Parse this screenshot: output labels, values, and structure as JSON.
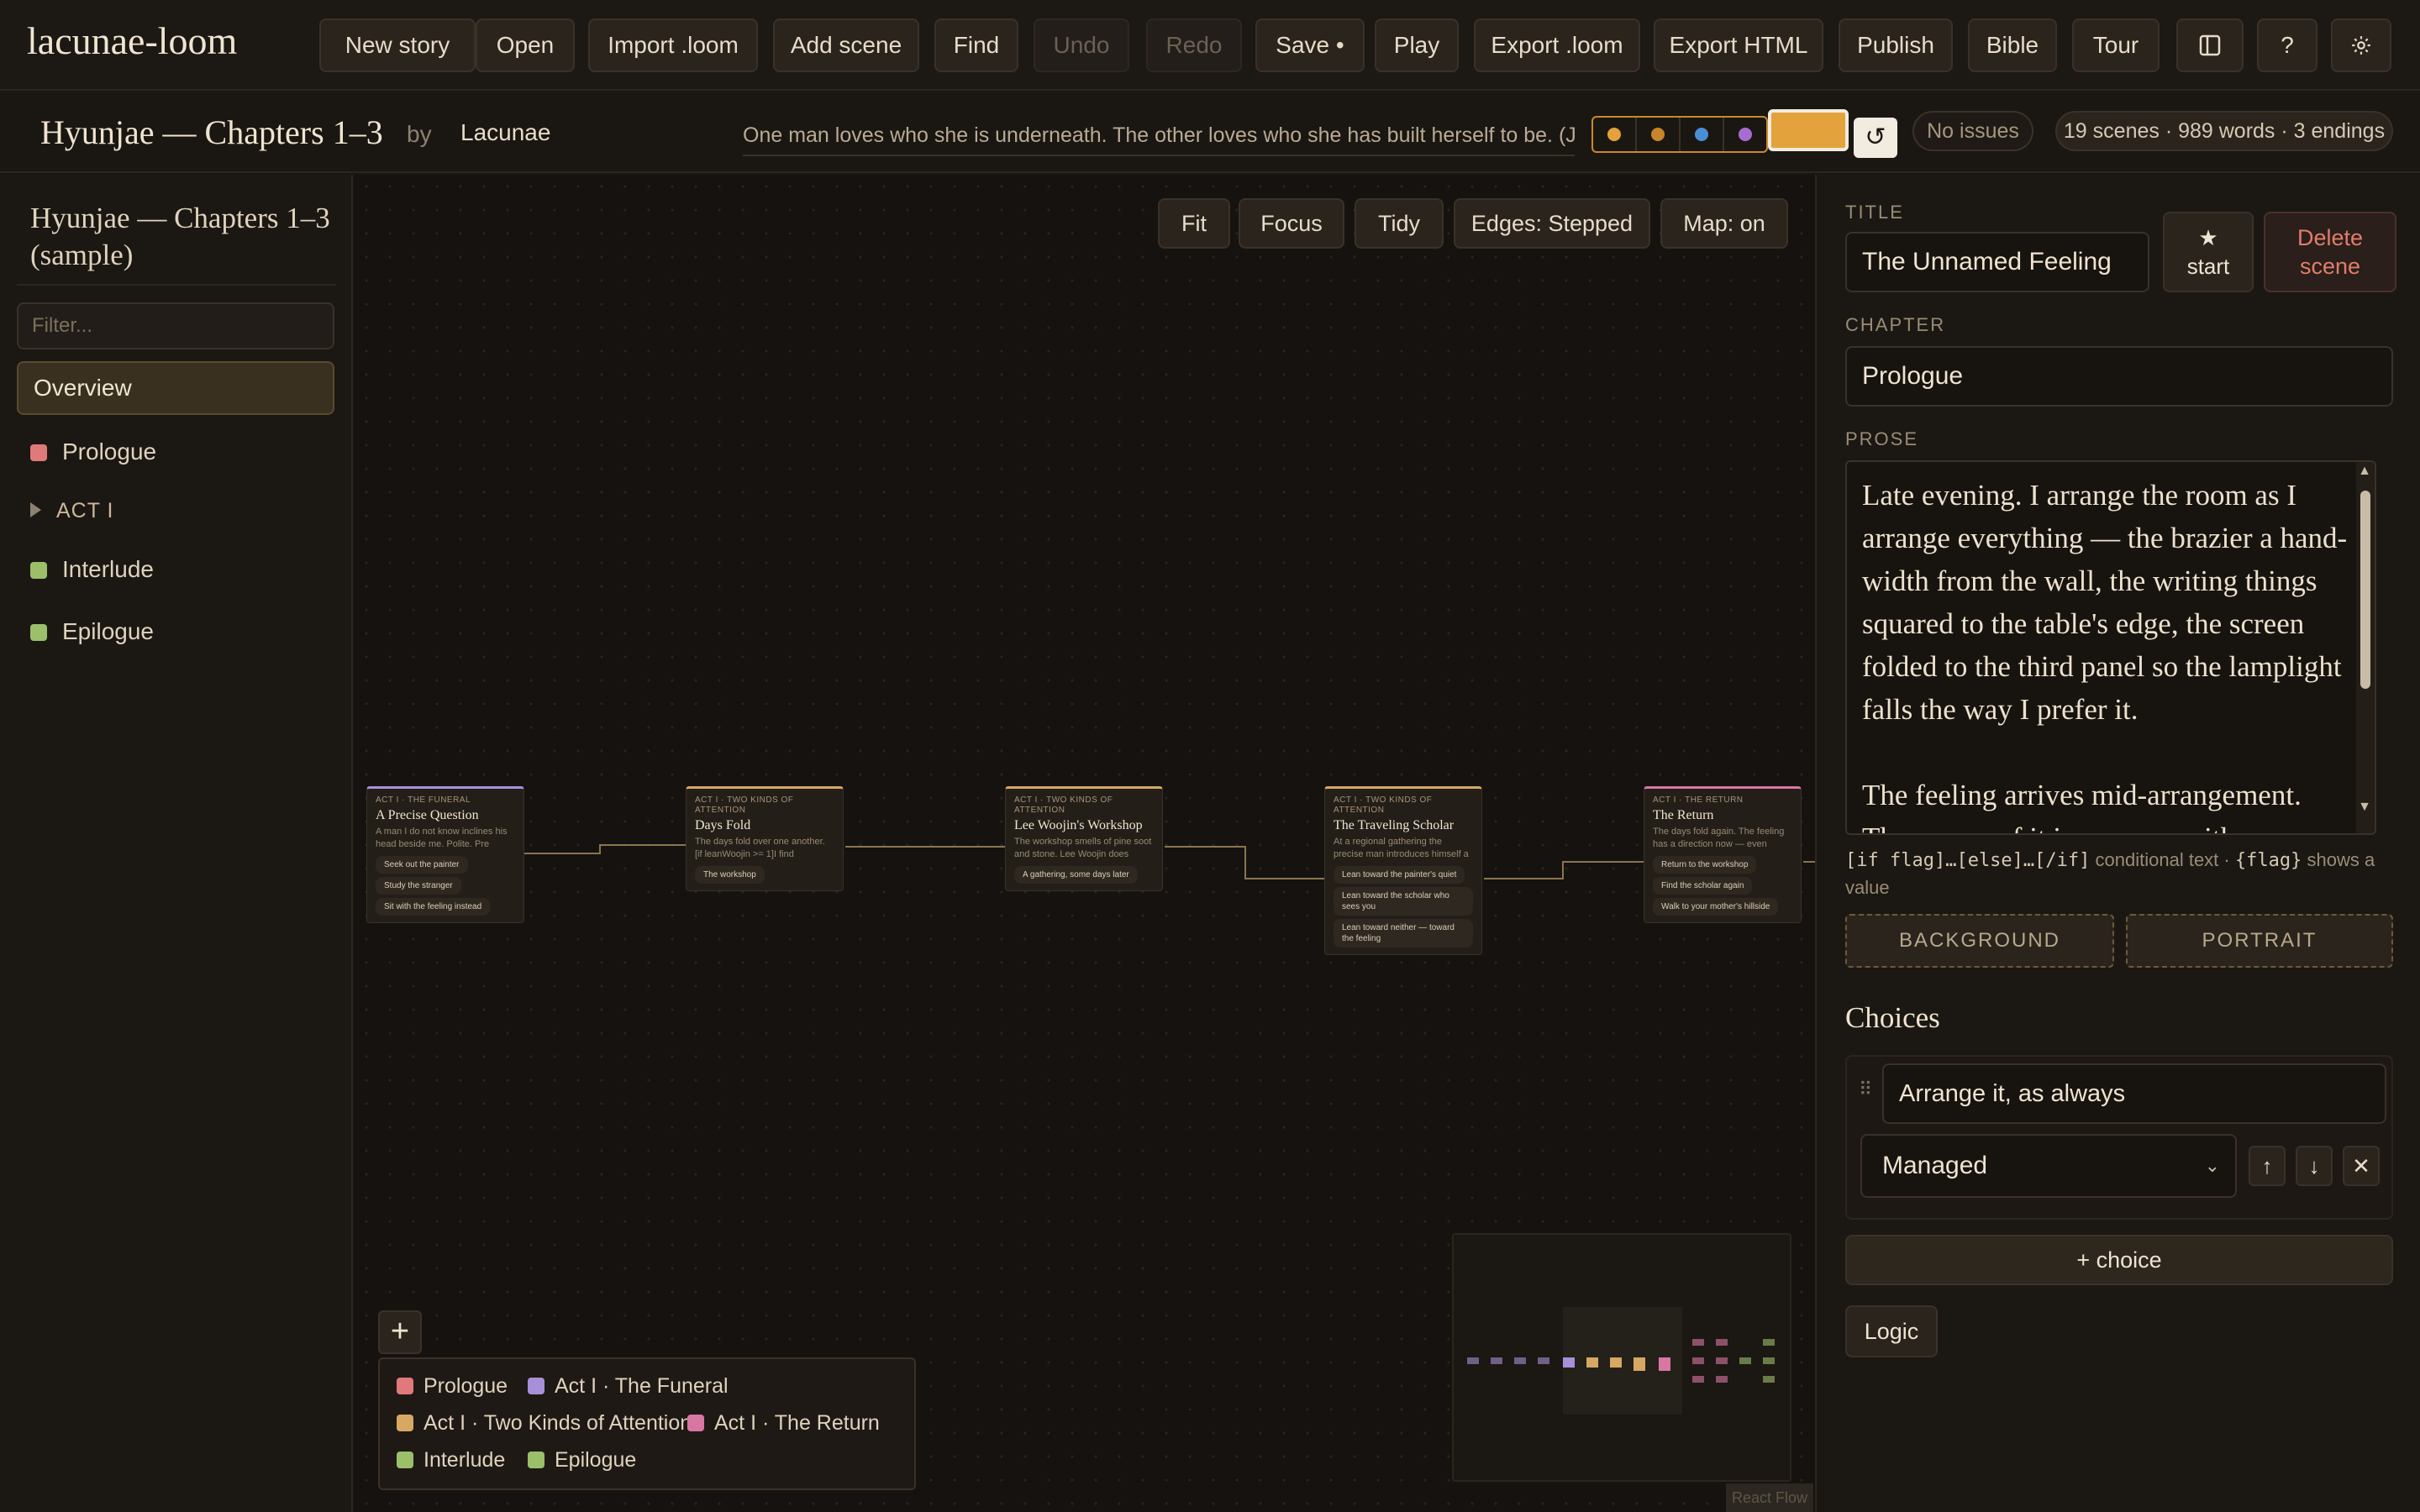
{
  "app": {
    "title": "lacunae-loom"
  },
  "toolbar": {
    "new_story": "New story",
    "open": "Open",
    "import_loom": "Import .loom",
    "add_scene": "Add scene",
    "find": "Find",
    "undo": "Undo",
    "redo": "Redo",
    "save": "Save •",
    "play": "Play",
    "export_loom": "Export .loom",
    "export_html": "Export HTML",
    "publish": "Publish",
    "bible": "Bible",
    "tour": "Tour",
    "sidebar_toggle_icon": "sidebar-icon",
    "help": "?",
    "settings_icon": "gear-icon"
  },
  "story": {
    "title": "Hyunjae — Chapters 1–3",
    "by": "by",
    "author": "Lacunae",
    "logline": "One man loves who she is underneath. The other loves who she has built herself to be. (Joseo",
    "swatch_colors": [
      "#e4a23c",
      "#c9852a",
      "#4a8fd6",
      "#a86cd1"
    ],
    "picked_color": "#e4a23c",
    "reset": "↺",
    "issues": "No issues",
    "stats": "19 scenes · 989 words · 3 endings"
  },
  "sidebar": {
    "story_title": "Hyunjae — Chapters 1–3 (sample)",
    "filter_placeholder": "Filter...",
    "overview": "Overview",
    "items": [
      {
        "label": "Prologue",
        "color": "#e07a7a"
      },
      {
        "label": "ACT I",
        "collapsed": true
      },
      {
        "label": "Interlude",
        "color": "#9cbf6a"
      },
      {
        "label": "Epilogue",
        "color": "#9cbf6a"
      }
    ]
  },
  "canvas": {
    "fit": "Fit",
    "focus": "Focus",
    "tidy": "Tidy",
    "edges": "Edges: Stepped",
    "map": "Map: on",
    "add_node": "+",
    "attribution": "React Flow",
    "nodes": [
      {
        "act": "ACT I · THE FUNERAL",
        "title": "A Precise Question",
        "body": "A man I do not know inclines his head beside me. Polite. Pre",
        "choices": [
          "Seek out the painter",
          "Study the stranger",
          "Sit with the feeling instead"
        ],
        "color": "#a890d8"
      },
      {
        "act": "ACT I · TWO KINDS OF ATTENTION",
        "title": "Days Fold",
        "body": "The days fold over one another. [if leanWoojin >= 1]I find",
        "choices": [
          "The workshop"
        ],
        "color": "#d6a862"
      },
      {
        "act": "ACT I · TWO KINDS OF ATTENTION",
        "title": "Lee Woojin's Workshop",
        "body": "The workshop smells of pine soot and stone. Lee Woojin does",
        "choices": [
          "A gathering, some days later"
        ],
        "color": "#d6a862"
      },
      {
        "act": "ACT I · TWO KINDS OF ATTENTION",
        "title": "The Traveling Scholar",
        "body": "At a regional gathering the precise man introduces himself a",
        "choices": [
          "Lean toward the painter's quiet",
          "Lean toward the scholar who sees you",
          "Lean toward neither — toward the feeling"
        ],
        "color": "#d6a862"
      },
      {
        "act": "ACT I · THE RETURN",
        "title": "The Return",
        "body": "The days fold again. The feeling has a direction now — even",
        "choices": [
          "Return to the workshop",
          "Find the scholar again",
          "Walk to your mother's hillside"
        ],
        "color": "#d977a3"
      }
    ],
    "legend": [
      {
        "label": "Prologue",
        "color": "#e07a7a"
      },
      {
        "label": "Act I · The Funeral",
        "color": "#a890d8"
      },
      {
        "label": "Act I · Two Kinds of Attention",
        "color": "#d6a862"
      },
      {
        "label": "Act I · The Return",
        "color": "#d977a3"
      },
      {
        "label": "Interlude",
        "color": "#9cbf6a"
      },
      {
        "label": "Epilogue",
        "color": "#9cbf6a"
      }
    ]
  },
  "inspector": {
    "title_label": "TITLE",
    "title_value": "The Unnamed Feeling",
    "start_star": "★",
    "start_label": "start",
    "delete_label": "Delete scene",
    "chapter_label": "CHAPTER",
    "chapter_value": "Prologue",
    "prose_label": "PROSE",
    "prose_text": "Late evening. I arrange the room as I arrange everything — the brazier a hand-width from the wall, the writing things squared to the table's edge, the screen folded to the third panel so the lamplight falls the way I prefer it.\n\nThe feeling arrives mid-arrangement.\nThe screen of it is a screen with a",
    "hint_if": "[if flag]…[else]…[/if]",
    "hint_if_desc": "conditional text ·",
    "hint_flag": "{flag}",
    "hint_flag_desc": "shows a value",
    "background_btn": "BACKGROUND",
    "portrait_btn": "PORTRAIT",
    "choices_heading": "Choices",
    "choice": {
      "text": "Arrange it, as always",
      "target": "Managed"
    },
    "move_up": "↑",
    "move_down": "↓",
    "remove": "✕",
    "add_choice": "+ choice",
    "logic": "Logic"
  }
}
